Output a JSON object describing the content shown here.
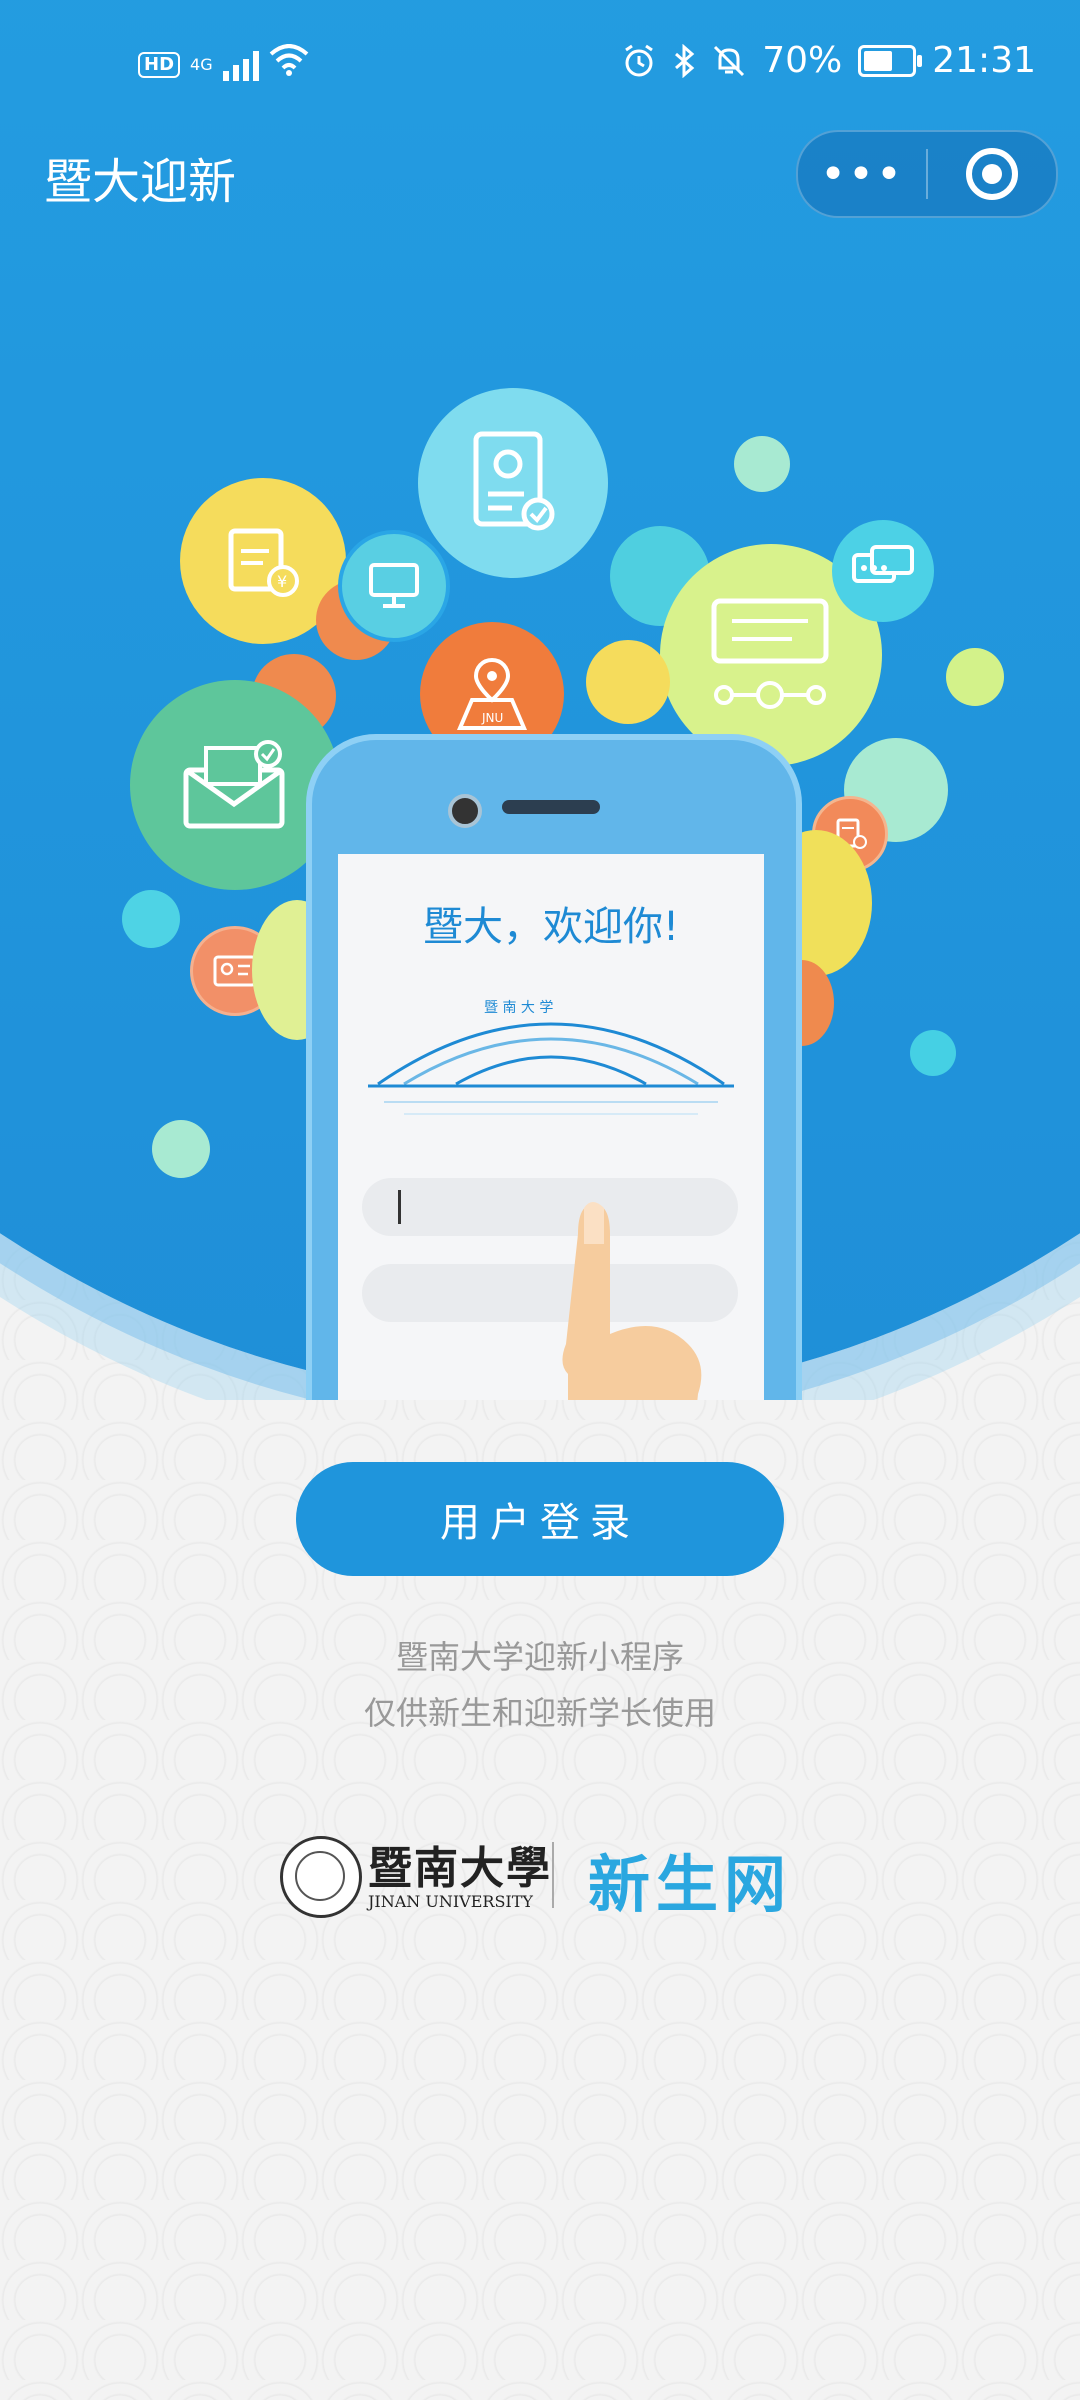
{
  "status_bar": {
    "hd": "HD",
    "network": "4G",
    "battery_percent_text": "70%",
    "battery_level": 0.7,
    "time": "21:31"
  },
  "header": {
    "title": "暨大迎新",
    "more_label": "•••"
  },
  "illustration": {
    "welcome_text": "暨大，欢迎你!",
    "map_label": "JNU",
    "seal_text": "暨 南 大 学",
    "seal_en": "JINAN UNIVERSITY"
  },
  "login": {
    "button_label": "用户登录"
  },
  "description": {
    "line1": "暨南大学迎新小程序",
    "line2": "仅供新生和迎新学长使用"
  },
  "footer": {
    "university_cn": "暨南大學",
    "university_en": "JINAN UNIVERSITY",
    "brand": "新生网"
  },
  "colors": {
    "primary": "#1f95dc",
    "header_bg": "#2aa6e6"
  }
}
